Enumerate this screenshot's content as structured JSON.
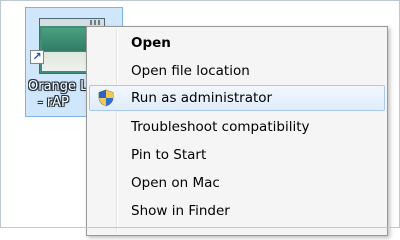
{
  "desktop_icon": {
    "label_line1": "Orange L",
    "label_line2": "- rAP",
    "shortcut_glyph": "↗"
  },
  "context_menu": {
    "items": [
      {
        "label": "Open",
        "bold": true,
        "highlighted": false,
        "icon": null
      },
      {
        "label": "Open file location",
        "bold": false,
        "highlighted": false,
        "icon": null
      },
      {
        "label": "Run as administrator",
        "bold": false,
        "highlighted": true,
        "icon": "uac-shield-icon"
      },
      {
        "label": "Troubleshoot compatibility",
        "bold": false,
        "highlighted": false,
        "icon": null
      },
      {
        "label": "Pin to Start",
        "bold": false,
        "highlighted": false,
        "icon": null
      },
      {
        "label": "Open on Mac",
        "bold": false,
        "highlighted": false,
        "icon": null
      },
      {
        "label": "Show in Finder",
        "bold": false,
        "highlighted": false,
        "icon": null
      }
    ]
  },
  "colors": {
    "menu_background": "#f5f5f5",
    "highlight_border": "#a9c9ec",
    "icon_selection": "#cfe6fb"
  }
}
